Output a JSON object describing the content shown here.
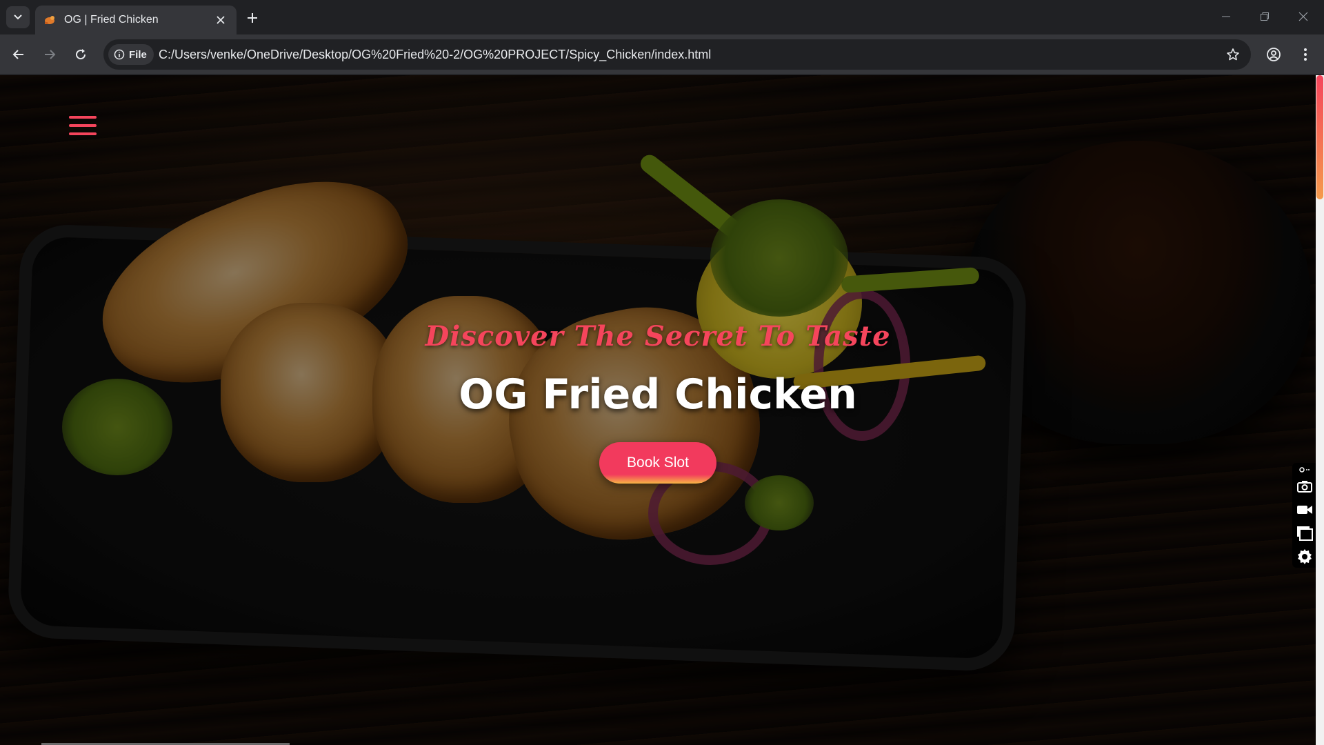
{
  "browser": {
    "tab_title": "OG | Fried Chicken",
    "address_chip": "File",
    "url": "C:/Users/venke/OneDrive/Desktop/OG%20Fried%20-2/OG%20PROJECT/Spicy_Chicken/index.html",
    "icons": [
      "tab-search-icon",
      "favicon-icon",
      "close-tab-icon",
      "new-tab-icon",
      "minimize-icon",
      "restore-icon",
      "close-window-icon",
      "back-icon",
      "forward-icon",
      "reload-icon",
      "info-icon",
      "bookmark-star-icon",
      "profile-icon",
      "menu-dots-icon"
    ]
  },
  "hero": {
    "tagline": "Discover The Secret To Taste",
    "headline": "OG Fried Chicken",
    "cta_label": "Book Slot"
  },
  "side_widget": {
    "icons": [
      "pin-icon",
      "camera-icon",
      "video-icon",
      "window-icon",
      "settings-icon"
    ]
  },
  "colors": {
    "accent": "#f5455c",
    "button_gradient_end": "#f7b545",
    "chrome_dark": "#202124",
    "chrome_mid": "#35363a"
  }
}
